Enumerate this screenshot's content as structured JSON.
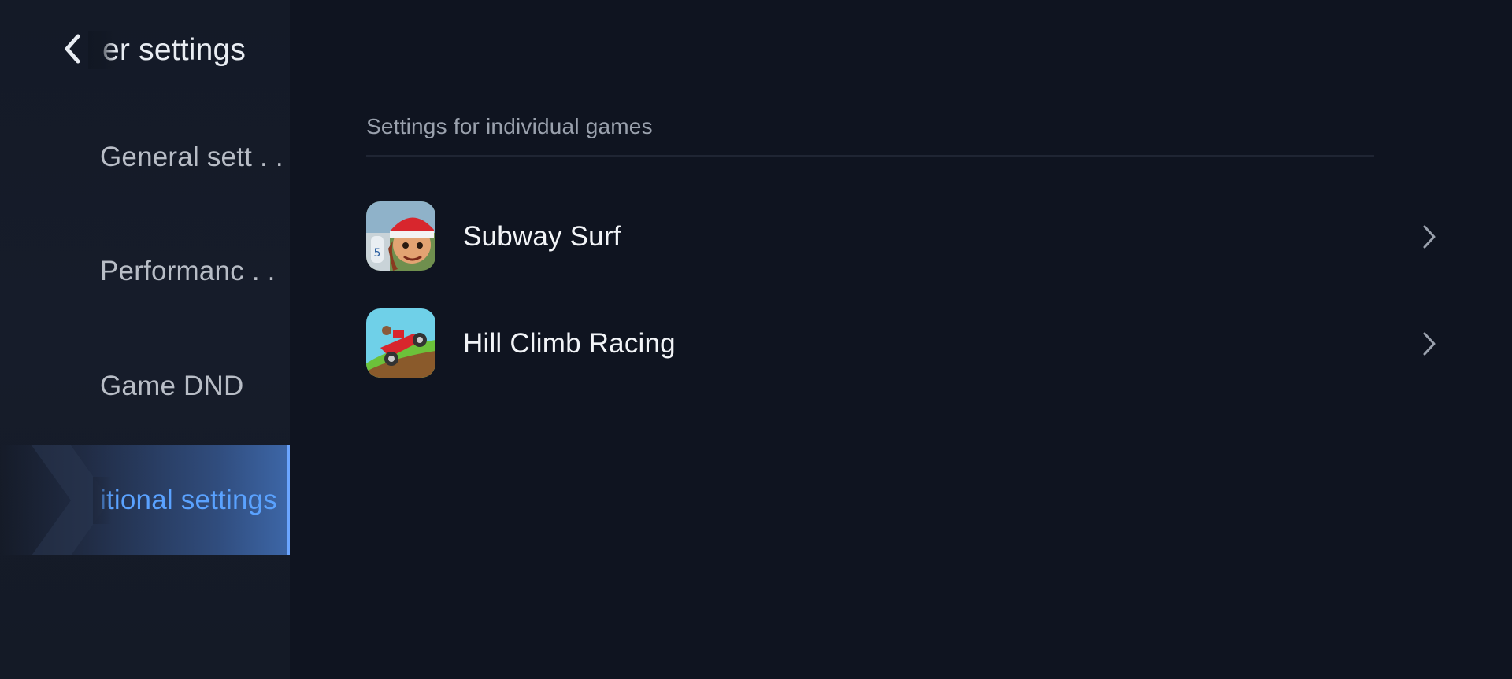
{
  "header": {
    "title": "er settings",
    "back_icon": "chevron-left-icon"
  },
  "sidebar": {
    "items": [
      {
        "label": "General sett . .",
        "active": false
      },
      {
        "label": "Performanc . .",
        "active": false
      },
      {
        "label": "Game DND",
        "active": false
      },
      {
        "label": "itional settings",
        "active": true
      }
    ]
  },
  "main": {
    "section_title": "Settings for individual games",
    "games": [
      {
        "name": "Subway Surf",
        "icon": "subway-surf-app-icon"
      },
      {
        "name": "Hill Climb Racing",
        "icon": "hill-climb-racing-app-icon"
      }
    ]
  },
  "colors": {
    "background": "#0f1420",
    "sidebar": "#151b28",
    "accent": "#5aa2ff",
    "text_primary": "#f2f4f7",
    "text_secondary": "#b8bdc6"
  }
}
